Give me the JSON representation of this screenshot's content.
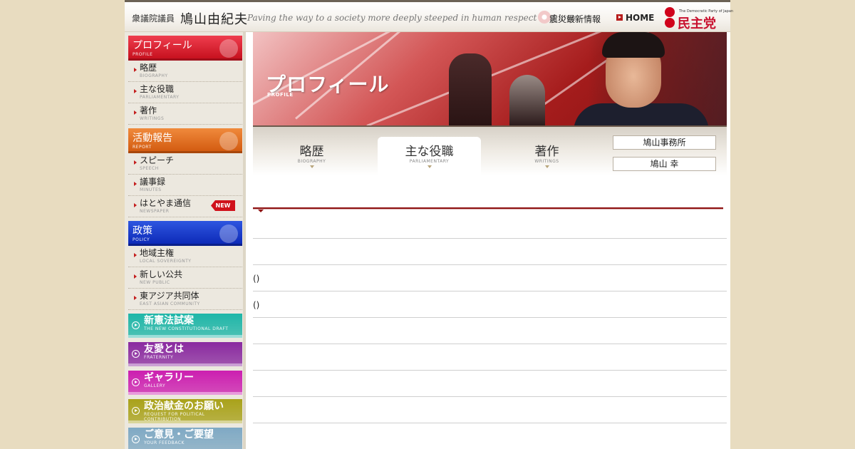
{
  "header": {
    "role": "衆議院議員",
    "name": "鳩山由紀夫",
    "tagline": "Paving the way to a society more deeply steeped in human respect and love.",
    "disaster_link": "震災最新情報",
    "home_link": "HOME",
    "party_small": "The Democratic Party of Japan",
    "party_name": "民主党"
  },
  "sidebar": {
    "profile": {
      "title": "プロフィール",
      "title_en": "PROFILE",
      "items": [
        {
          "jp": "略歴",
          "en": "BIOGRAPHY"
        },
        {
          "jp": "主な役職",
          "en": "PARLIAMENTARY"
        },
        {
          "jp": "著作",
          "en": "WRITINGS"
        }
      ]
    },
    "report": {
      "title": "活動報告",
      "title_en": "REPORT",
      "items": [
        {
          "jp": "スピーチ",
          "en": "SPEECH"
        },
        {
          "jp": "議事録",
          "en": "MINUTES"
        },
        {
          "jp": "はとやま通信",
          "en": "NEWSPAPER",
          "badge": "NEW"
        }
      ]
    },
    "policy": {
      "title": "政策",
      "title_en": "POLICY",
      "items": [
        {
          "jp": "地域主権",
          "en": "LOCAL SOVEREIGNTY"
        },
        {
          "jp": "新しい公共",
          "en": "NEW PUBLIC"
        },
        {
          "jp": "東アジア共同体",
          "en": "EAST ASIAN COMMUNITY"
        }
      ]
    },
    "banners": [
      {
        "jp": "新憲法試案",
        "en": "THE NEW CONSTITUTIONAL DRAFT",
        "color": "#1fb6a8"
      },
      {
        "jp": "友愛とは",
        "en": "FRATERNITY",
        "color": "#8a2aa0"
      },
      {
        "jp": "ギャラリー",
        "en": "GALLERY",
        "color": "#cc1fb0"
      },
      {
        "jp": "政治献金のお願い",
        "en": "REQUEST FOR POLITICAL CONTRIBUTION",
        "color": "#a9a21a"
      },
      {
        "jp": "ご意見・ご要望",
        "en": "YOUR FEEDBACK",
        "color": "#7fa9c4"
      }
    ]
  },
  "hero": {
    "title": "プロフィール",
    "subtitle": "PROFILE"
  },
  "tabs": [
    {
      "jp": "略歴",
      "en": "BIOGRAPHY",
      "active": false
    },
    {
      "jp": "主な役職",
      "en": "PARLIAMENTARY",
      "active": true
    },
    {
      "jp": "著作",
      "en": "WRITINGS",
      "active": false
    }
  ],
  "side_buttons": [
    "鳩山事務所",
    "鳩山 幸"
  ],
  "rows": [
    "",
    "",
    "()",
    "()",
    "",
    "",
    "",
    "",
    ""
  ]
}
